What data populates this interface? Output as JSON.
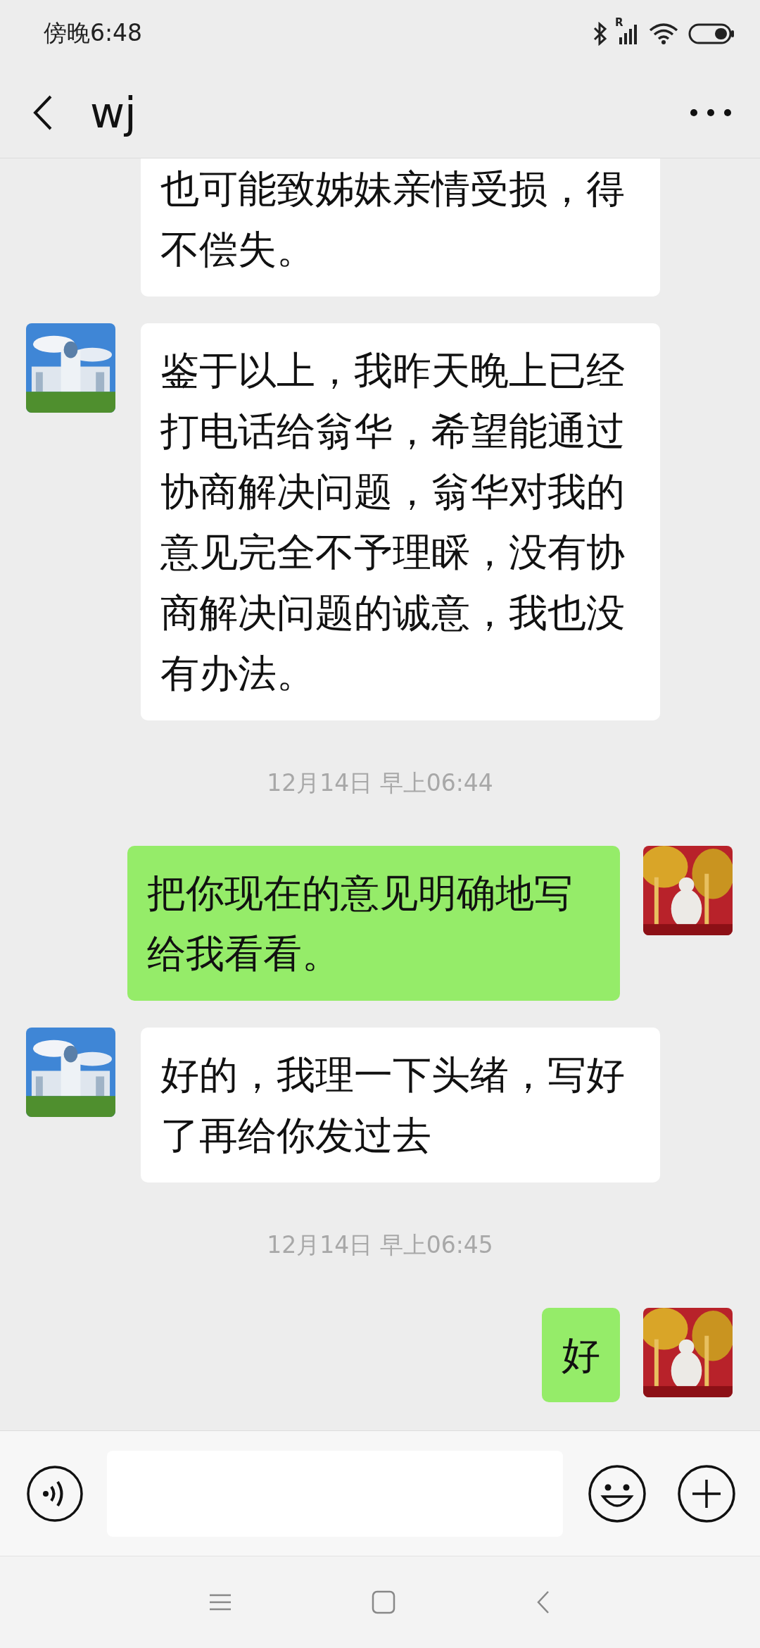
{
  "status_bar": {
    "time": "傍晚6:48",
    "signal_mark": "R"
  },
  "header": {
    "title": "wj"
  },
  "messages": [
    {
      "kind": "received",
      "clipped": true,
      "text": "也可能致姊妹亲情受损，得不偿失。"
    },
    {
      "kind": "received",
      "clipped": false,
      "text": "鉴于以上，我昨天晚上已经打电话给翁华，希望能通过协商解决问题，翁华对我的意见完全不予理睬，没有协商解决问题的诚意，我也没有办法。"
    },
    {
      "kind": "time",
      "text": "12月14日 早上06:44"
    },
    {
      "kind": "sent",
      "clipped": false,
      "text": "把你现在的意见明确地写给我看看。"
    },
    {
      "kind": "received",
      "clipped": false,
      "text": "好的，我理一下头绪，写好了再给你发过去"
    },
    {
      "kind": "time",
      "text": "12月14日 早上06:45"
    },
    {
      "kind": "sent",
      "clipped": false,
      "text": "好"
    }
  ]
}
